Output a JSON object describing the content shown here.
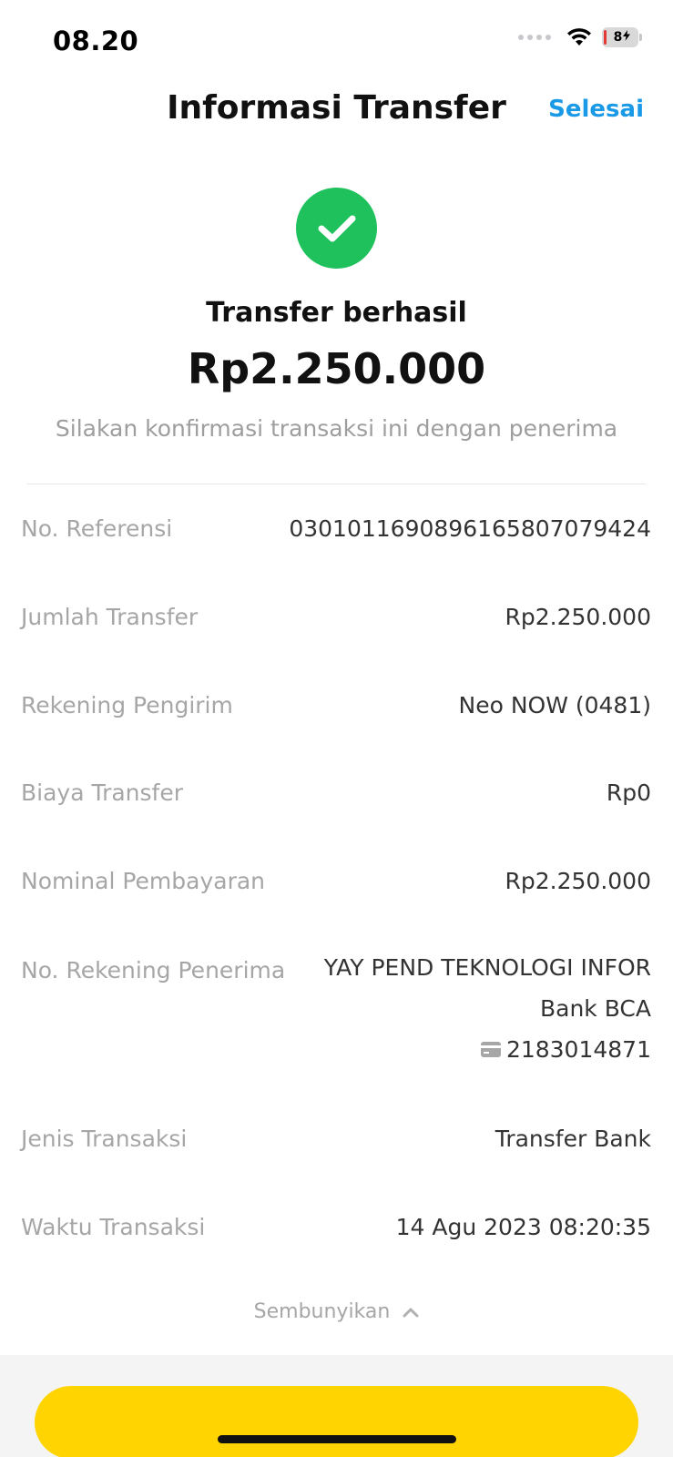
{
  "status_bar": {
    "time": "08.20",
    "battery_level": "8"
  },
  "header": {
    "title": "Informasi Transfer",
    "done_label": "Selesai"
  },
  "result": {
    "title": "Transfer berhasil",
    "amount": "Rp2.250.000",
    "note": "Silakan konfirmasi transaksi ini dengan penerima",
    "status_color": "#1ec15b"
  },
  "details": [
    {
      "label": "No. Referensi",
      "value": "030101169089616580707942​4"
    },
    {
      "label": "Jumlah Transfer",
      "value": "Rp2.250.000"
    },
    {
      "label": "Rekening Pengirim",
      "value": "Neo NOW (0481)"
    },
    {
      "label": "Biaya Transfer",
      "value": "Rp0"
    },
    {
      "label": "Nominal Pembayaran",
      "value": "Rp2.250.000"
    },
    {
      "label": "No. Rekening Penerima",
      "name": "YAY PEND TEKNOLOGI INFOR",
      "bank": "Bank BCA",
      "account": "2183014871"
    },
    {
      "label": "Jenis Transaksi",
      "value": "Transfer Bank"
    },
    {
      "label": "Waktu Transaksi",
      "value": "14 Agu 2023 08:20:35"
    }
  ],
  "toggle": {
    "label": "Sembunyikan"
  },
  "colors": {
    "accent": "#1a9ae6",
    "button": "#ffd400",
    "success": "#1ec15b"
  }
}
